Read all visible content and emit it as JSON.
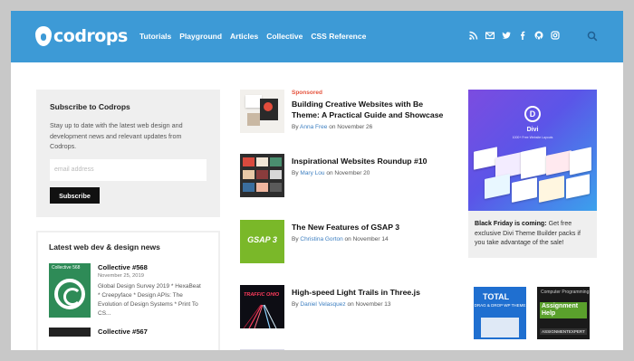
{
  "header": {
    "logo_text": "codrops",
    "nav": [
      "Tutorials",
      "Playground",
      "Articles",
      "Collective",
      "CSS Reference"
    ],
    "social_icons": [
      "rss-icon",
      "mail-icon",
      "twitter-icon",
      "facebook-icon",
      "github-icon",
      "instagram-icon"
    ],
    "search_icon": "search-icon",
    "color": "#3d9ad6"
  },
  "subscribe": {
    "title": "Subscribe to Codrops",
    "text": "Stay up to date with the latest web design and development news and relevant updates from Codrops.",
    "email_placeholder": "email address",
    "button": "Subscribe"
  },
  "latest": {
    "title": "Latest web dev & design news",
    "items": [
      {
        "thumb_label": "Collective 568",
        "title": "Collective #568",
        "date": "November 25, 2019",
        "desc": "Global Design Survey 2019 * HexaBeat * Creepyface * Design APIs: The Evolution of Design Systems * Print To CS..."
      },
      {
        "title": "Collective #567"
      }
    ]
  },
  "articles": [
    {
      "sponsored": "Sponsored",
      "title": "Building Creative Websites with Be Theme: A Practical Guide and Showcase",
      "by": "By",
      "author": "Anna Free",
      "on": "on",
      "date": "November 26"
    },
    {
      "title": "Inspirational Websites Roundup #10",
      "by": "By",
      "author": "Mary Lou",
      "on": "on",
      "date": "November 20"
    },
    {
      "title": "The New Features of GSAP 3",
      "by": "By",
      "author": "Christina Gorton",
      "on": "on",
      "date": "November 14",
      "thumb_text": "GSAP 3"
    },
    {
      "title": "High-speed Light Trails in Three.js",
      "by": "By",
      "author": "Daniel Velasquez",
      "on": "on",
      "date": "November 13",
      "thumb_text": "TRAFFIC OHIO"
    }
  ],
  "divi": {
    "logo_letter": "D",
    "name": "Divi",
    "tagline": "1000+ Free Website Layouts",
    "bold": "Black Friday is coming:",
    "text": " Get free exclusive Divi Theme Builder packs if you take advantage of the sale!"
  },
  "ads": {
    "total": {
      "title": "TOTAL",
      "sub": "DRAG & DROP WP THEME"
    },
    "assignment": {
      "top": "Computer Programming",
      "main": "Assignment Help",
      "footer": "ASSIGNMENTEXPERT"
    }
  }
}
